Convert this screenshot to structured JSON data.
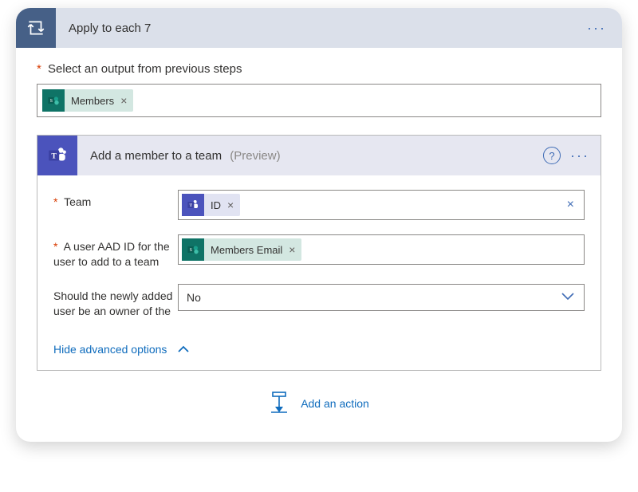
{
  "loop": {
    "title": "Apply to each 7",
    "kebab": "···"
  },
  "outputSection": {
    "label": "Select an output from previous steps",
    "token": {
      "label": "Members",
      "close": "×",
      "icon": "sharepoint-icon"
    }
  },
  "action": {
    "title": "Add a member to a team",
    "preview": "(Preview)",
    "help": "?",
    "kebab": "···",
    "params": {
      "team": {
        "label": "Team",
        "token": {
          "label": "ID",
          "close": "×",
          "icon": "teams-icon"
        },
        "clear": "×"
      },
      "user": {
        "label": "A user AAD ID for the user to add to a team",
        "token": {
          "label": "Members Email",
          "close": "×",
          "icon": "sharepoint-icon"
        }
      },
      "owner": {
        "label": "Should the newly added user be an owner of the",
        "value": "No"
      }
    },
    "advancedToggle": "Hide advanced options"
  },
  "addAction": {
    "label": "Add an action"
  }
}
